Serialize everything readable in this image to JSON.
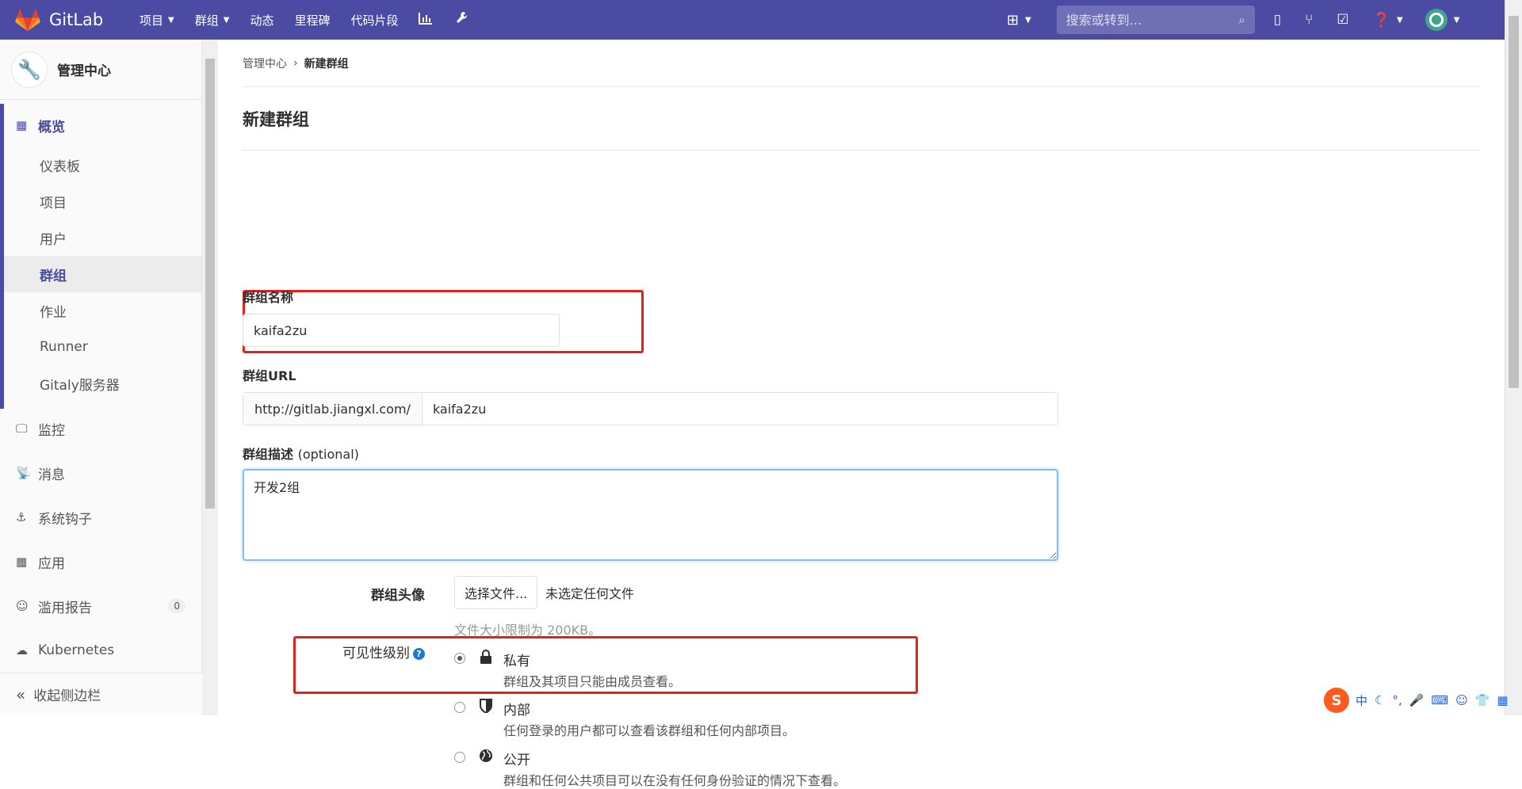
{
  "brand": {
    "name": "GitLab"
  },
  "top_nav": {
    "items": [
      {
        "label": "项目",
        "dropdown": true
      },
      {
        "label": "群组",
        "dropdown": true
      },
      {
        "label": "动态",
        "dropdown": false
      },
      {
        "label": "里程碑",
        "dropdown": false
      },
      {
        "label": "代码片段",
        "dropdown": false
      }
    ],
    "icons": [
      "chart-icon",
      "wrench-icon"
    ],
    "search_placeholder": "搜索或转到..."
  },
  "sidebar": {
    "header_title": "管理中心",
    "overview": {
      "label": "概览",
      "subitems": [
        "仪表板",
        "项目",
        "用户",
        "群组",
        "作业",
        "Runner",
        "Gitaly服务器"
      ],
      "active_subitem": "群组"
    },
    "items": [
      {
        "label": "监控",
        "icon": "monitor-icon"
      },
      {
        "label": "消息",
        "icon": "broadcast-icon"
      },
      {
        "label": "系统钩子",
        "icon": "hook-icon"
      },
      {
        "label": "应用",
        "icon": "apps-icon"
      },
      {
        "label": "滥用报告",
        "icon": "smile-icon",
        "badge": "0"
      },
      {
        "label": "Kubernetes",
        "icon": "cloud-gear-icon"
      }
    ],
    "collapse_label": "收起侧边栏"
  },
  "breadcrumb": {
    "root": "管理中心",
    "current": "新建群组"
  },
  "page": {
    "title": "新建群组"
  },
  "form": {
    "group_name": {
      "label": "群组名称",
      "value": "kaifa2zu"
    },
    "group_url": {
      "label": "群组URL",
      "prefix": "http://gitlab.jiangxl.com/",
      "value": "kaifa2zu"
    },
    "description": {
      "label": "群组描述",
      "optional": "(optional)",
      "value": "开发2组"
    },
    "avatar": {
      "label": "群组头像",
      "button": "选择文件...",
      "status": "未选定任何文件",
      "help": "文件大小限制为 200KB。"
    },
    "visibility": {
      "label": "可见性级别",
      "help_icon": "?",
      "options": [
        {
          "title": "私有",
          "desc": "群组及其项目只能由成员查看。",
          "checked": true,
          "icon": "lock-icon"
        },
        {
          "title": "内部",
          "desc": "任何登录的用户都可以查看该群组和任何内部项目。",
          "checked": false,
          "icon": "shield-icon"
        },
        {
          "title": "公开",
          "desc": "群组和任何公共项目可以在没有任何身份验证的情况下查看。",
          "checked": false,
          "icon": "globe-icon"
        }
      ]
    }
  },
  "tray": {
    "ime_label": "中"
  },
  "colors": {
    "nav": "#4b4ba3",
    "accent": "#4b4ba3",
    "highlight": "#e0221e",
    "help": "#1f78d1"
  }
}
